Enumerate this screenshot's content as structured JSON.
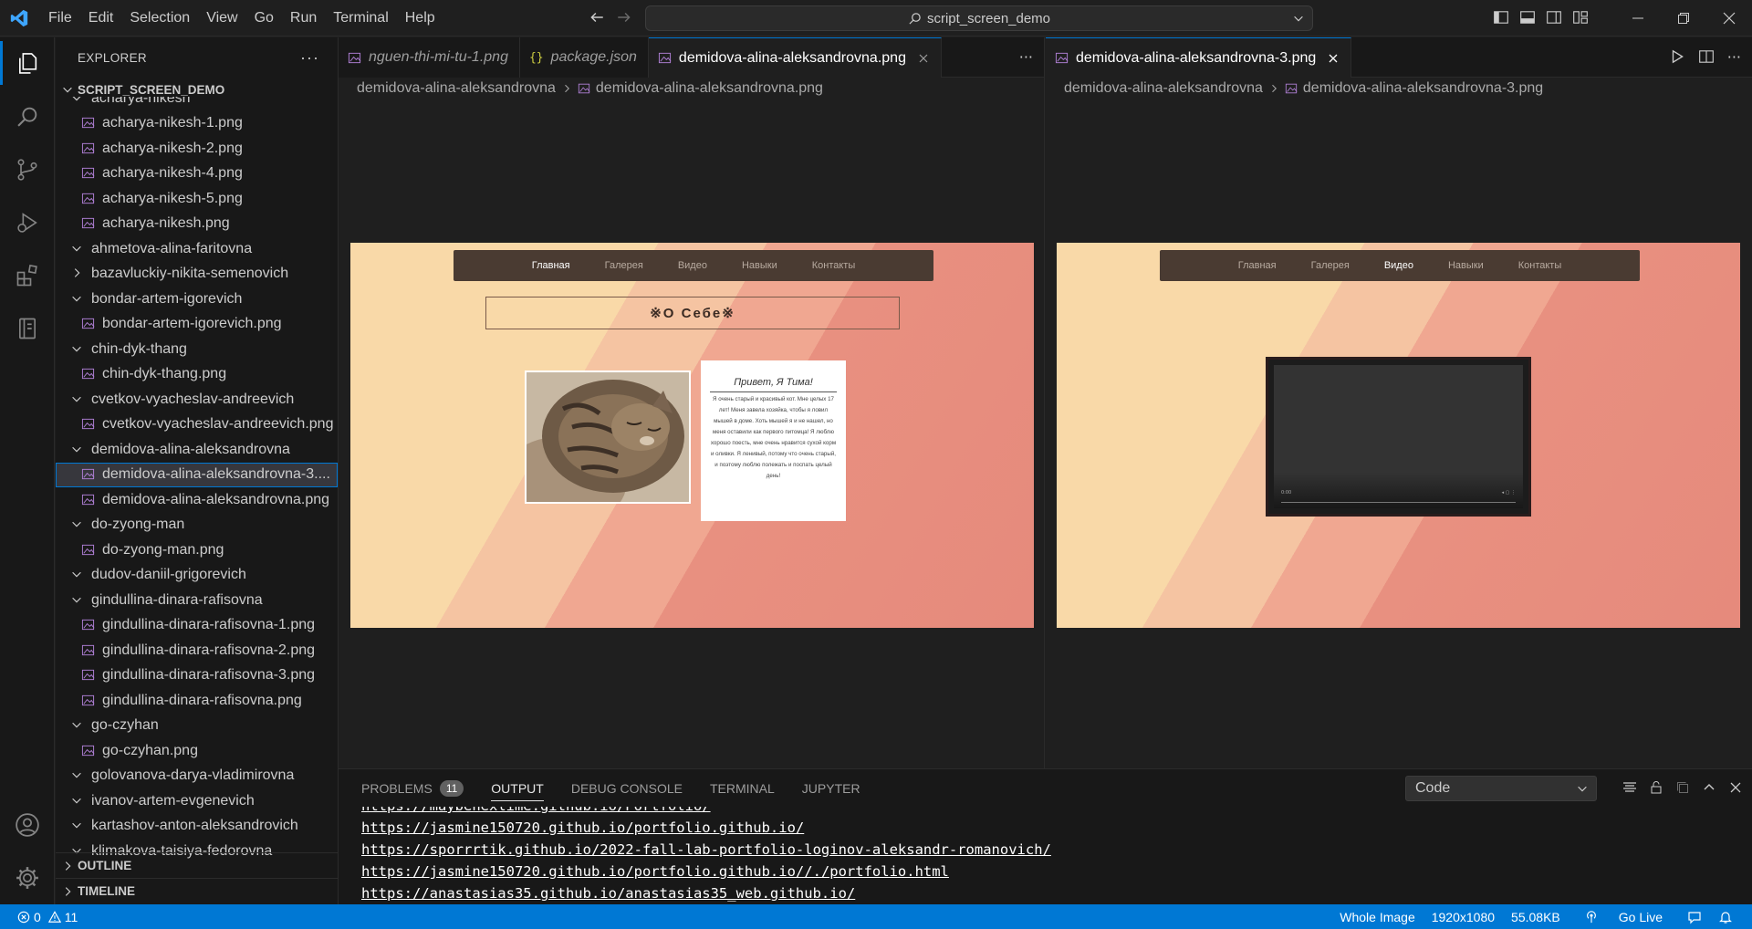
{
  "titlebar": {
    "menu": [
      "File",
      "Edit",
      "Selection",
      "View",
      "Go",
      "Run",
      "Terminal",
      "Help"
    ],
    "search_text": "script_screen_demo"
  },
  "explorer": {
    "title": "EXPLORER",
    "workspace": "SCRIPT_SCREEN_DEMO",
    "tree": [
      {
        "label": "acharya-nikesh",
        "kind": "folder-partial"
      },
      {
        "label": "acharya-nikesh-1.png",
        "kind": "file"
      },
      {
        "label": "acharya-nikesh-2.png",
        "kind": "file"
      },
      {
        "label": "acharya-nikesh-4.png",
        "kind": "file"
      },
      {
        "label": "acharya-nikesh-5.png",
        "kind": "file"
      },
      {
        "label": "acharya-nikesh.png",
        "kind": "file"
      },
      {
        "label": "ahmetova-alina-faritovna",
        "kind": "folder-open"
      },
      {
        "label": "bazavluckiy-nikita-semenovich",
        "kind": "folder-closed"
      },
      {
        "label": "bondar-artem-igorevich",
        "kind": "folder-open"
      },
      {
        "label": "bondar-artem-igorevich.png",
        "kind": "file"
      },
      {
        "label": "chin-dyk-thang",
        "kind": "folder-open"
      },
      {
        "label": "chin-dyk-thang.png",
        "kind": "file"
      },
      {
        "label": "cvetkov-vyacheslav-andreevich",
        "kind": "folder-open"
      },
      {
        "label": "cvetkov-vyacheslav-andreevich.png",
        "kind": "file"
      },
      {
        "label": "demidova-alina-aleksandrovna",
        "kind": "folder-open"
      },
      {
        "label": "demidova-alina-aleksandrovna-3....",
        "kind": "file-selected"
      },
      {
        "label": "demidova-alina-aleksandrovna.png",
        "kind": "file"
      },
      {
        "label": "do-zyong-man",
        "kind": "folder-open"
      },
      {
        "label": "do-zyong-man.png",
        "kind": "file"
      },
      {
        "label": "dudov-daniil-grigorevich",
        "kind": "folder-open"
      },
      {
        "label": "gindullina-dinara-rafisovna",
        "kind": "folder-open"
      },
      {
        "label": "gindullina-dinara-rafisovna-1.png",
        "kind": "file"
      },
      {
        "label": "gindullina-dinara-rafisovna-2.png",
        "kind": "file"
      },
      {
        "label": "gindullina-dinara-rafisovna-3.png",
        "kind": "file"
      },
      {
        "label": "gindullina-dinara-rafisovna.png",
        "kind": "file"
      },
      {
        "label": "go-czyhan",
        "kind": "folder-open"
      },
      {
        "label": "go-czyhan.png",
        "kind": "file"
      },
      {
        "label": "golovanova-darya-vladimirovna",
        "kind": "folder-open"
      },
      {
        "label": "ivanov-artem-evgenevich",
        "kind": "folder-open"
      },
      {
        "label": "kartashov-anton-aleksandrovich",
        "kind": "folder-open"
      },
      {
        "label": "klimakova-taisiya-fedorovna",
        "kind": "folder-partial"
      }
    ],
    "outline_label": "OUTLINE",
    "timeline_label": "TIMELINE"
  },
  "group1": {
    "tabs": [
      {
        "label": "nguen-thi-mi-tu-1.png",
        "icon": "image-icon",
        "style": "preview"
      },
      {
        "label": "package.json",
        "icon": "json-icon",
        "style": "preview"
      },
      {
        "label": "demidova-alina-aleksandrovna.png",
        "icon": "image-icon",
        "style": "active"
      }
    ],
    "breadcrumb_folder": "demidova-alina-aleksandrovna",
    "breadcrumb_file": "demidova-alina-aleksandrovna.png"
  },
  "group2": {
    "tabs": [
      {
        "label": "demidova-alina-aleksandrovna-3.png",
        "icon": "image-icon",
        "style": "active"
      }
    ],
    "breadcrumb_folder": "demidova-alina-aleksandrovna",
    "breadcrumb_file": "demidova-alina-aleksandrovna-3.png"
  },
  "site1": {
    "nav": [
      "Главная",
      "Галерея",
      "Видео",
      "Навыки",
      "Контакты"
    ],
    "active_nav": 0,
    "title": "※О Себе※",
    "card_heading": "Привет, Я Тима!",
    "card_text": "Я очень старый и красивый кот. Мне целых 17 лет! Меня завела хозяйка, чтобы я ловил мышей в доме. Хоть мышей я и не нашел, но меня оставили как первого питомца! Я люблю хорошо поесть, мне очень нравится сухой корм и оливки. Я ленивый, потому что очень старый, и поэтому люблю полежать и поспать целый день!"
  },
  "site2": {
    "nav": [
      "Главная",
      "Галерея",
      "Видео",
      "Навыки",
      "Контакты"
    ],
    "active_nav": 2,
    "video_time": "0:00"
  },
  "panel": {
    "tabs": [
      "PROBLEMS",
      "OUTPUT",
      "DEBUG CONSOLE",
      "TERMINAL",
      "JUPYTER"
    ],
    "active_tab": "OUTPUT",
    "problems_count": "11",
    "select_value": "Code",
    "output_lines": [
      "https://maybenexlime.github.io/Portfolio/",
      "https://jasmine150720.github.io/portfolio.github.io/",
      "https://sporrrtik.github.io/2022-fall-lab-portfolio-loginov-aleksandr-romanovich/",
      "https://jasmine150720.github.io/portfolio.github.io//./portfolio.html",
      "https://anastasias35.github.io/anastasias35_web.github.io/"
    ]
  },
  "statusbar": {
    "errors": "0",
    "warnings": "11",
    "whole_image": "Whole Image",
    "dimensions": "1920x1080",
    "filesize": "55.08KB",
    "go_live": "Go Live"
  },
  "colors": {
    "accent": "#0078d4",
    "image_icon": "#b180d7",
    "json_icon": "#cbcb41"
  }
}
